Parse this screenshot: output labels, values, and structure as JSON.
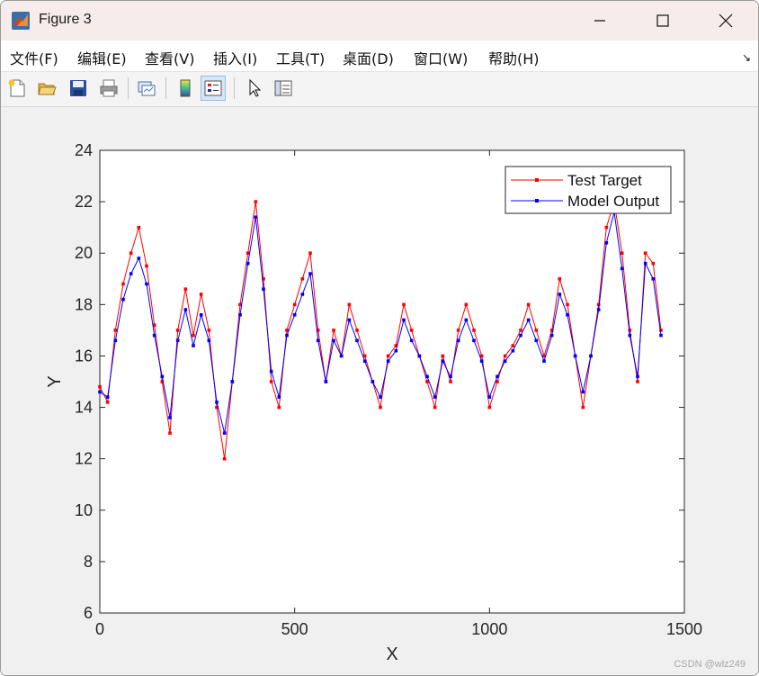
{
  "window": {
    "title": "Figure 3",
    "icon": "matlab-icon",
    "controls": [
      "minimize-icon",
      "maximize-icon",
      "close-icon"
    ]
  },
  "menu": {
    "items": [
      "文件(F)",
      "编辑(E)",
      "查看(V)",
      "插入(I)",
      "工具(T)",
      "桌面(D)",
      "窗口(W)",
      "帮助(H)"
    ],
    "overflow_arrow": "↘"
  },
  "toolbar": {
    "buttons": [
      "new-figure-icon",
      "open-file-icon",
      "save-icon",
      "print-icon",
      "link-plot-icon",
      "insert-colorbar-icon",
      "insert-legend-icon",
      "edit-plot-arrow-icon",
      "property-inspector-icon"
    ],
    "active": "insert-legend-icon"
  },
  "colors": {
    "target": "#ff0000",
    "output": "#0000ff",
    "titlebar": "#f6ecea"
  },
  "chart_data": {
    "type": "line",
    "xlabel": "X",
    "ylabel": "Y",
    "xlim": [
      0,
      1500
    ],
    "ylim": [
      6,
      24
    ],
    "xticks": [
      0,
      500,
      1000,
      1500
    ],
    "yticks": [
      6,
      8,
      10,
      12,
      14,
      16,
      18,
      20,
      22,
      24
    ],
    "legend_position": "top-right",
    "grid": false,
    "series": [
      {
        "name": "Test Target",
        "color": "#ff0000",
        "marker": "square",
        "x": [
          0,
          20,
          40,
          60,
          80,
          100,
          120,
          140,
          160,
          180,
          200,
          220,
          240,
          260,
          280,
          300,
          320,
          340,
          360,
          380,
          400,
          420,
          440,
          460,
          480,
          500,
          520,
          540,
          560,
          580,
          600,
          620,
          640,
          660,
          680,
          700,
          720,
          740,
          760,
          780,
          800,
          820,
          840,
          860,
          880,
          900,
          920,
          940,
          960,
          980,
          1000,
          1020,
          1040,
          1060,
          1080,
          1100,
          1120,
          1140,
          1160,
          1180,
          1200,
          1220,
          1240,
          1260,
          1280,
          1300,
          1320,
          1340,
          1360,
          1380,
          1400,
          1420,
          1440
        ],
        "y": [
          14.8,
          14.2,
          17.0,
          18.8,
          20.0,
          21.0,
          19.5,
          17.2,
          15.0,
          13.0,
          17.0,
          18.6,
          16.8,
          18.4,
          17.0,
          14.0,
          12.0,
          15.0,
          18.0,
          20.0,
          22.0,
          19.0,
          15.0,
          14.0,
          17.0,
          18.0,
          19.0,
          20.0,
          17.0,
          15.0,
          17.0,
          16.0,
          18.0,
          17.0,
          16.0,
          15.0,
          14.0,
          16.0,
          16.4,
          18.0,
          17.0,
          16.0,
          15.0,
          14.0,
          16.0,
          15.0,
          17.0,
          18.0,
          17.0,
          16.0,
          14.0,
          15.0,
          16.0,
          16.4,
          17.0,
          18.0,
          17.0,
          16.0,
          17.0,
          19.0,
          18.0,
          16.0,
          14.0,
          16.0,
          18.0,
          21.0,
          22.0,
          20.0,
          17.0,
          15.0,
          20.0,
          19.6,
          17.0
        ]
      },
      {
        "name": "Model Output",
        "color": "#0000ff",
        "marker": "square",
        "x": [
          0,
          20,
          40,
          60,
          80,
          100,
          120,
          140,
          160,
          180,
          200,
          220,
          240,
          260,
          280,
          300,
          320,
          340,
          360,
          380,
          400,
          420,
          440,
          460,
          480,
          500,
          520,
          540,
          560,
          580,
          600,
          620,
          640,
          660,
          680,
          700,
          720,
          740,
          760,
          780,
          800,
          820,
          840,
          860,
          880,
          900,
          920,
          940,
          960,
          980,
          1000,
          1020,
          1040,
          1060,
          1080,
          1100,
          1120,
          1140,
          1160,
          1180,
          1200,
          1220,
          1240,
          1260,
          1280,
          1300,
          1320,
          1340,
          1360,
          1380,
          1400,
          1420,
          1440
        ],
        "y": [
          14.6,
          14.4,
          16.6,
          18.2,
          19.2,
          19.8,
          18.8,
          16.8,
          15.2,
          13.6,
          16.6,
          17.8,
          16.4,
          17.6,
          16.6,
          14.2,
          13.0,
          15.0,
          17.6,
          19.6,
          21.4,
          18.6,
          15.4,
          14.4,
          16.8,
          17.6,
          18.4,
          19.2,
          16.6,
          15.0,
          16.6,
          16.0,
          17.4,
          16.6,
          15.8,
          15.0,
          14.4,
          15.8,
          16.2,
          17.4,
          16.6,
          16.0,
          15.2,
          14.4,
          15.8,
          15.2,
          16.6,
          17.4,
          16.6,
          15.8,
          14.4,
          15.2,
          15.8,
          16.2,
          16.8,
          17.4,
          16.6,
          15.8,
          16.8,
          18.4,
          17.6,
          16.0,
          14.6,
          16.0,
          17.8,
          20.4,
          21.6,
          19.4,
          16.8,
          15.2,
          19.6,
          19.0,
          16.8
        ]
      }
    ]
  },
  "footer": {
    "watermark": "CSDN @wlz249"
  }
}
